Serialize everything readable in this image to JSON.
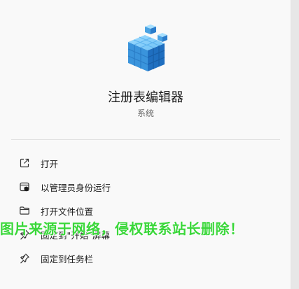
{
  "app": {
    "title": "注册表编辑器",
    "subtitle": "系统",
    "icon": "registry-cubes-icon",
    "accent": "#2e8fd8"
  },
  "menu": {
    "items": [
      {
        "label": "打开",
        "icon": "open-external-icon"
      },
      {
        "label": "以管理员身份运行",
        "icon": "shield-admin-icon"
      },
      {
        "label": "打开文件位置",
        "icon": "folder-icon"
      },
      {
        "label": "固定到\"开始\"屏幕",
        "icon": "pin-icon"
      },
      {
        "label": "固定到任务栏",
        "icon": "pin-icon"
      }
    ]
  },
  "watermark": {
    "text": "图片来源于网络，侵权联系站长删除！",
    "color": "#3ad73a"
  }
}
